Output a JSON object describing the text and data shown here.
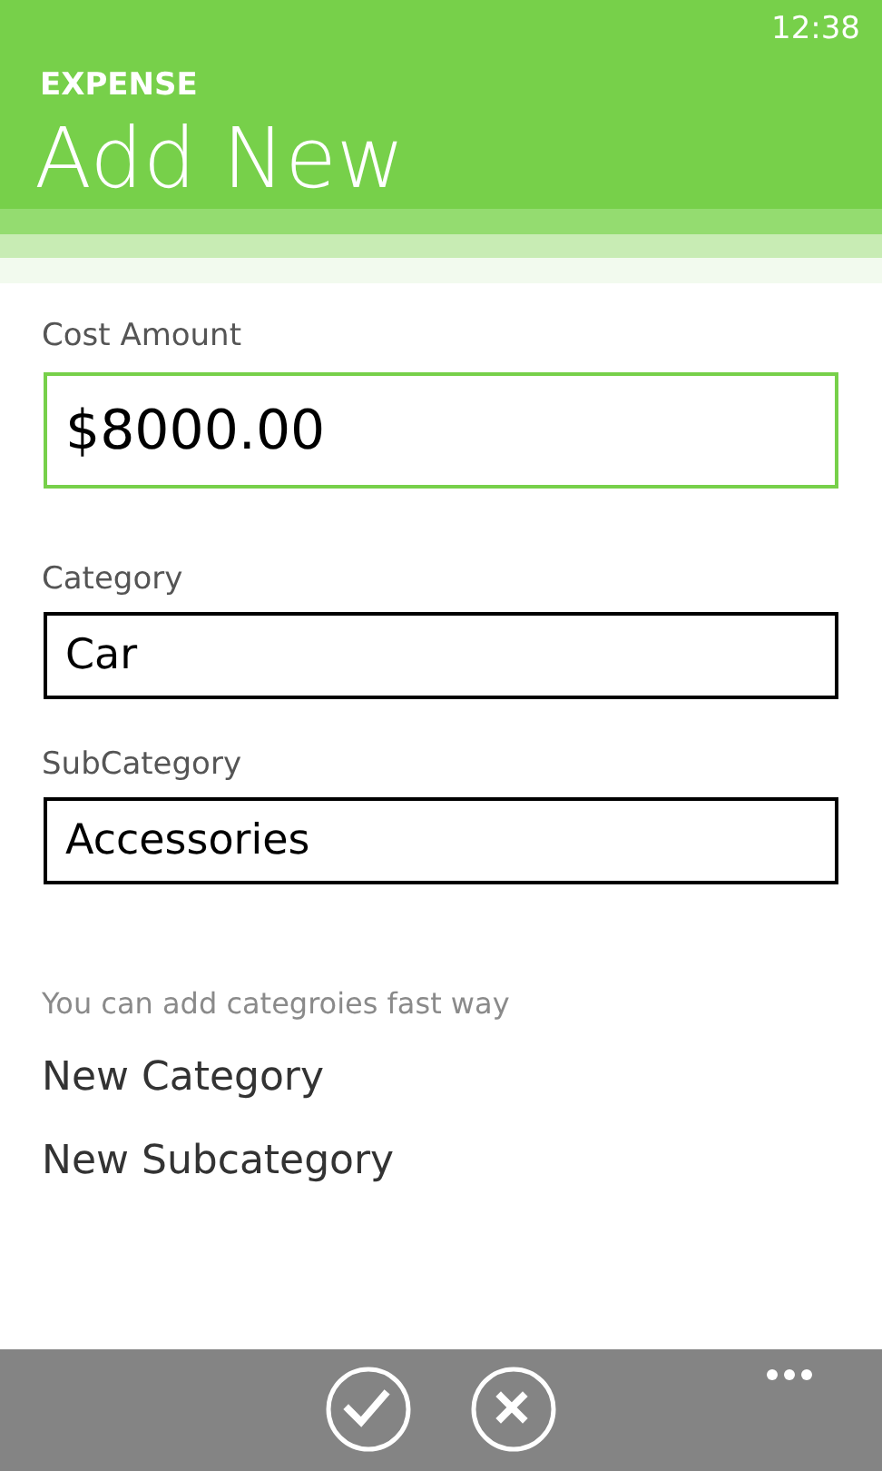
{
  "status_bar": {
    "time": "12:38"
  },
  "header": {
    "app_title": "EXPENSE",
    "page_title": "Add New"
  },
  "fields": [
    {
      "label": "Cost Amount",
      "value": "$8000.00",
      "focused": true
    },
    {
      "label": "Category",
      "value": "Car",
      "focused": false
    },
    {
      "label": "SubCategory",
      "value": "Accessories",
      "focused": false
    }
  ],
  "hint": "You can add categroies fast way",
  "links": [
    "New Category",
    "New Subcategory"
  ],
  "app_bar": {
    "buttons": [
      {
        "kind": "confirm"
      },
      {
        "kind": "cancel"
      }
    ]
  }
}
